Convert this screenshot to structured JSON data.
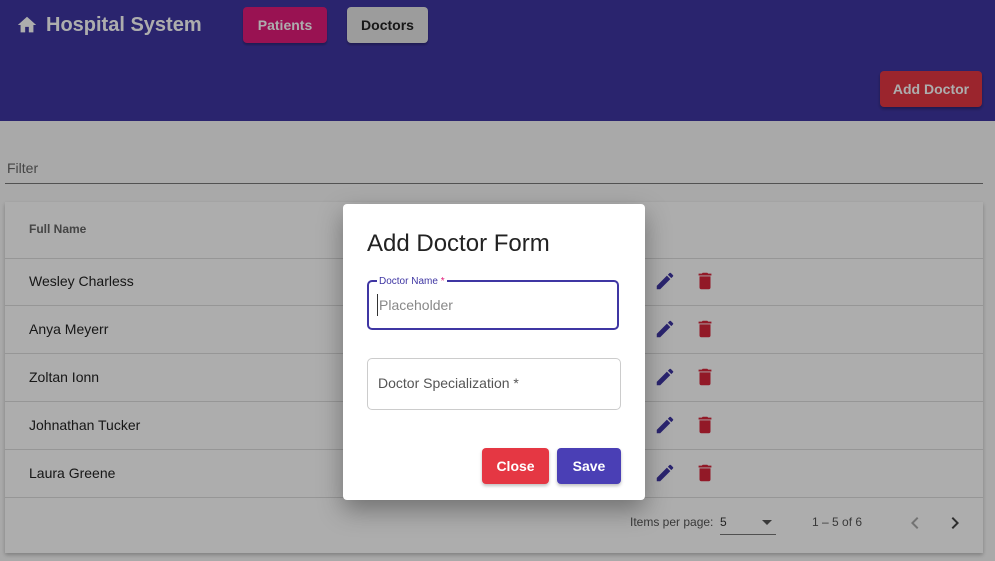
{
  "header": {
    "title": "Hospital System",
    "home_icon": "home-icon",
    "nav": [
      {
        "label": "Patients",
        "color": "#e21b79"
      },
      {
        "label": "Doctors",
        "color": "#e6e6e6"
      }
    ],
    "add_doctor_label": "Add Doctor",
    "background": "#3f36a3"
  },
  "filter": {
    "placeholder": "Filter",
    "value": ""
  },
  "table": {
    "column_header": "Full Name",
    "rows": [
      {
        "name": "Wesley Charless"
      },
      {
        "name": "Anya Meyerr"
      },
      {
        "name": "Zoltan Ionn"
      },
      {
        "name": "Johnathan Tucker"
      },
      {
        "name": "Laura Greene"
      }
    ],
    "row_icons": [
      "edit-icon",
      "delete-icon"
    ]
  },
  "paginator": {
    "items_per_page_label": "Items per page:",
    "items_per_page_value": "5",
    "range_label": "1 – 5 of 6",
    "prev_icon": "chevron-left-icon",
    "next_icon": "chevron-right-icon"
  },
  "dialog": {
    "title": "Add Doctor Form",
    "name_field": {
      "label": "Doctor Name",
      "required_mark": "*",
      "placeholder": "Placeholder",
      "value": ""
    },
    "specialization_field": {
      "label": "Doctor Specialization *",
      "value": ""
    },
    "close_label": "Close",
    "save_label": "Save"
  },
  "colors": {
    "primary": "#3f36a3",
    "accent": "#e21b79",
    "warn": "#e53743"
  }
}
